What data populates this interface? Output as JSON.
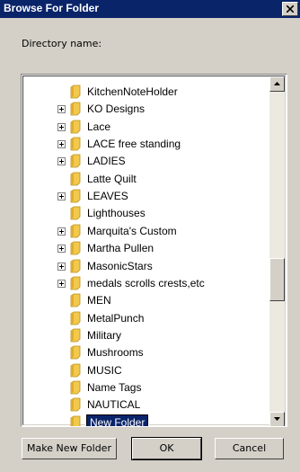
{
  "window": {
    "title": "Browse For Folder",
    "close_symbol": "×"
  },
  "directory_label": "Directory name:",
  "tree": {
    "items": [
      {
        "label": "KitchenNoteHolder",
        "expandable": false
      },
      {
        "label": "KO Designs",
        "expandable": true
      },
      {
        "label": "Lace",
        "expandable": true
      },
      {
        "label": "LACE free standing",
        "expandable": true
      },
      {
        "label": "LADIES",
        "expandable": true
      },
      {
        "label": "Latte Quilt",
        "expandable": false
      },
      {
        "label": "LEAVES",
        "expandable": true
      },
      {
        "label": "Lighthouses",
        "expandable": false
      },
      {
        "label": "Marquita's Custom",
        "expandable": true
      },
      {
        "label": "Martha Pullen",
        "expandable": true
      },
      {
        "label": "MasonicStars",
        "expandable": true
      },
      {
        "label": "medals scrolls crests,etc",
        "expandable": true
      },
      {
        "label": "MEN",
        "expandable": false
      },
      {
        "label": "MetalPunch",
        "expandable": false
      },
      {
        "label": "Military",
        "expandable": false
      },
      {
        "label": "Mushrooms",
        "expandable": false
      },
      {
        "label": "MUSIC",
        "expandable": false
      },
      {
        "label": "Name Tags",
        "expandable": false
      },
      {
        "label": "NAUTICAL",
        "expandable": false
      },
      {
        "label": "New Folder",
        "expandable": false,
        "editing": true
      }
    ]
  },
  "buttons": {
    "make_new_folder": "Make New Folder",
    "ok": "OK",
    "cancel": "Cancel"
  },
  "colors": {
    "title_bar": "#0a246a",
    "dialog_bg": "#d4d0c8",
    "folder": "#f2c94c"
  },
  "icons": {
    "folder": "folder-icon",
    "expand": "plus-box-icon",
    "close": "close-icon",
    "scroll_up": "arrow-up-icon",
    "scroll_down": "arrow-down-icon"
  }
}
